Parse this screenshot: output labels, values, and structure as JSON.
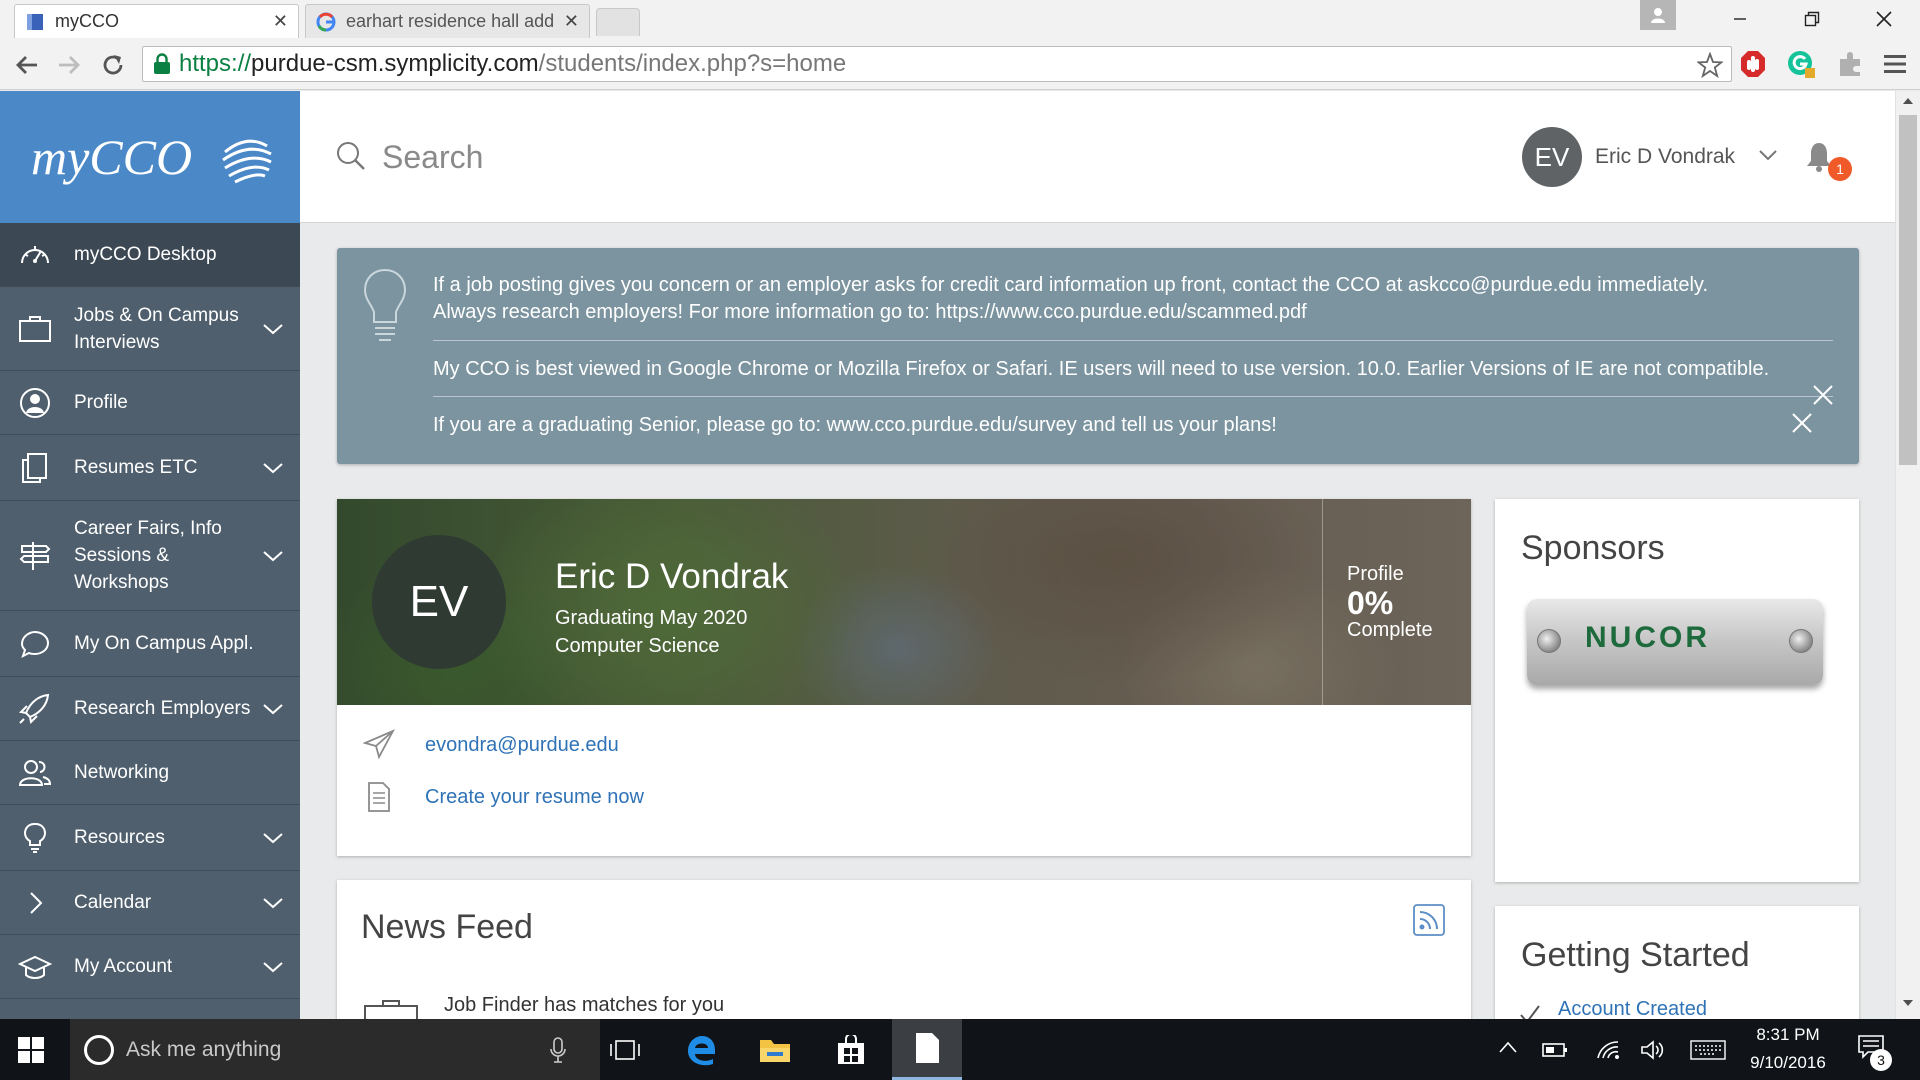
{
  "browser": {
    "tabs": [
      {
        "title": "myCCO"
      },
      {
        "title": "earhart residence hall add"
      }
    ],
    "url": {
      "secure_prefix": "https://",
      "host": "purdue-csm.symplicity.com",
      "path": "/students/index.php?s=home"
    }
  },
  "sidebar": {
    "logo_text": "myCCO",
    "items": [
      {
        "label": "myCCO Desktop",
        "icon": "dashboard-icon"
      },
      {
        "label": "Jobs & On Campus Interviews",
        "icon": "briefcase-icon"
      },
      {
        "label": "Profile",
        "icon": "user-icon"
      },
      {
        "label": "Resumes ETC",
        "icon": "documents-icon"
      },
      {
        "label": "Career Fairs, Info Sessions & Workshops",
        "icon": "signpost-icon"
      },
      {
        "label": "My On Campus Appl.",
        "icon": "chat-icon"
      },
      {
        "label": "Research Employers",
        "icon": "rocket-icon"
      },
      {
        "label": "Networking",
        "icon": "people-icon"
      },
      {
        "label": "Resources",
        "icon": "lightbulb-icon"
      },
      {
        "label": "Calendar",
        "icon": "chevron-right-icon"
      },
      {
        "label": "My Account",
        "icon": "graduation-cap-icon"
      }
    ]
  },
  "header": {
    "search_placeholder": "Search",
    "user_initials": "EV",
    "user_name": "Eric D Vondrak",
    "notification_count": "1"
  },
  "alerts": {
    "message_1_line_1": "If a job posting gives you concern or an employer asks for credit card information up front, contact the CCO at askcco@purdue.edu immediately.",
    "message_1_line_2": "Always research employers! For more information go to: https://www.cco.purdue.edu/scammed.pdf",
    "message_2": "My CCO is best viewed in Google Chrome or Mozilla Firefox or Safari. IE users will need to use version. 10.0. Earlier Versions of IE are not compatible.",
    "message_3": "If you are a graduating Senior, please go to: www.cco.purdue.edu/survey and tell us your plans!"
  },
  "profile_card": {
    "initials": "EV",
    "name": "Eric D Vondrak",
    "graduating": "Graduating May 2020",
    "major": "Computer Science",
    "profile_label": "Profile",
    "completion_percent": "0%",
    "completion_label": "Complete",
    "email": "evondra@purdue.edu",
    "resume_link": "Create your resume now"
  },
  "sponsors": {
    "title": "Sponsors",
    "logo_text": "NUCOR"
  },
  "news_feed": {
    "title": "News Feed",
    "items": [
      {
        "text": "Job Finder has matches for you"
      }
    ]
  },
  "getting_started": {
    "title": "Getting Started",
    "items": [
      {
        "label": "Account Created"
      }
    ]
  },
  "taskbar": {
    "search_placeholder": "Ask me anything",
    "time": "8:31 PM",
    "date": "9/10/2016",
    "notification_count": "3"
  },
  "colors": {
    "sidebar_bg": "#4f5f6d",
    "logo_bg": "#4a88c8",
    "alert_bg": "#7c949f",
    "link": "#2f73b6",
    "badge": "#ef5a28"
  }
}
